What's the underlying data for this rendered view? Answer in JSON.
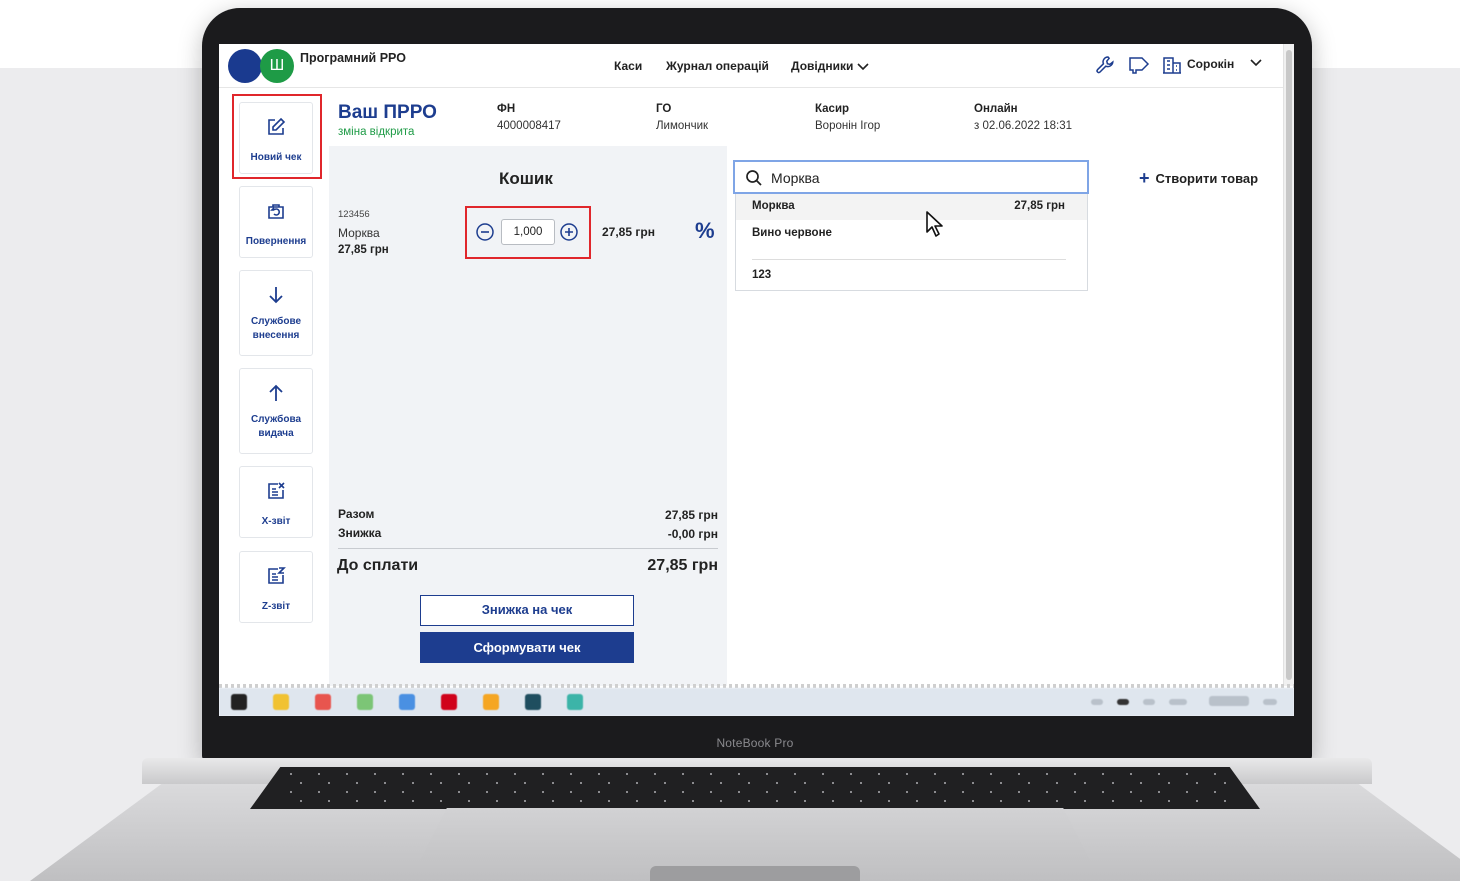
{
  "app": {
    "name": "Програмний РРО",
    "logo_emblem": "Ш"
  },
  "nav": {
    "items": [
      {
        "label": "Каси"
      },
      {
        "label": "Журнал операцій"
      },
      {
        "label": "Довідники"
      }
    ],
    "user": "Сорокін",
    "icons": [
      "wrench-icon",
      "megaphone-icon",
      "building-icon",
      "chevron-down-icon"
    ]
  },
  "sidebar": {
    "items": [
      {
        "label": "Новий чек",
        "icon": "edit-icon"
      },
      {
        "label": "Повернення",
        "icon": "return-bag-icon"
      },
      {
        "label": "Службове внесення",
        "icon": "arrow-down-icon"
      },
      {
        "label": "Службова видача",
        "icon": "arrow-up-icon"
      },
      {
        "label": "Х-звіт",
        "icon": "x-report-icon"
      },
      {
        "label": "Z-звіт",
        "icon": "z-report-icon"
      }
    ]
  },
  "header": {
    "title": "Ваш ПРРО",
    "status": "зміна відкрита",
    "fields": [
      {
        "label": "ФН",
        "value": "4000008417"
      },
      {
        "label": "ГО",
        "value": "Лимончик"
      },
      {
        "label": "Касир",
        "value": "Воронін Ігор"
      },
      {
        "label": "Онлайн",
        "value": "з 02.06.2022 18:31"
      }
    ]
  },
  "basket": {
    "title": "Кошик",
    "items": [
      {
        "code": "123456",
        "name": "Морква",
        "price": "27,85 грн",
        "qty": "1,000",
        "total": "27,85 грн"
      }
    ],
    "discount_symbol": "%",
    "summary": {
      "subtotal_label": "Разом",
      "subtotal": "27,85 грн",
      "discount_label": "Знижка",
      "discount": "-0,00 грн",
      "due_label": "До сплати",
      "due": "27,85 грн"
    },
    "discount_button": "Знижка на чек",
    "submit_button": "Сформувати чек"
  },
  "search": {
    "value": "Морква",
    "results": [
      {
        "name": "Морква",
        "price": "27,85 грн"
      },
      {
        "name": "Вино червоне"
      },
      {
        "name": "123"
      }
    ]
  },
  "create_product": "Створити товар",
  "laptop": {
    "brand": "NoteBook Pro"
  },
  "colors": {
    "primary": "#1d3d8f",
    "accent_green": "#1e9b46",
    "highlight_red": "#e0262b",
    "panel_bg": "#f1f3f6"
  }
}
